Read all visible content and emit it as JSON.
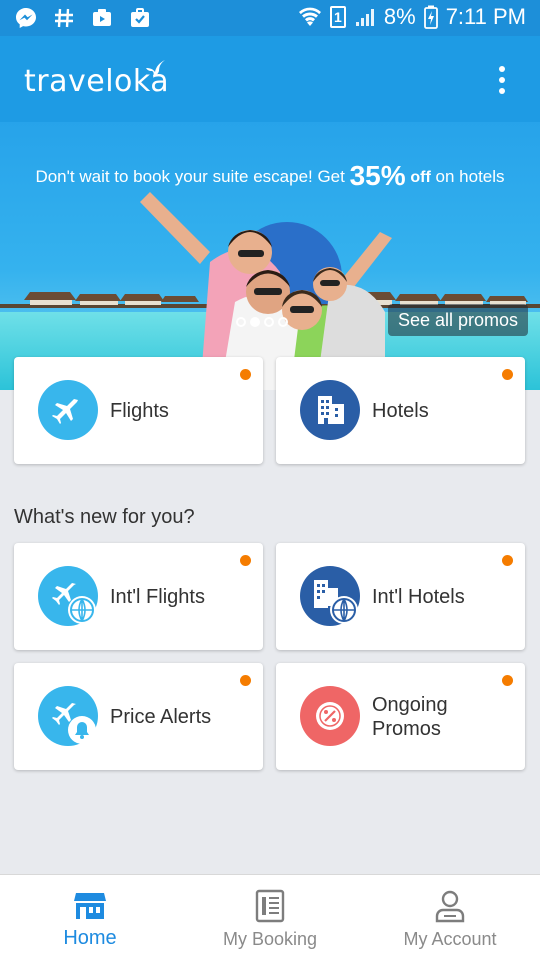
{
  "status_bar": {
    "battery": "8%",
    "time": "7:11 PM",
    "sim": "1",
    "left_icons": [
      "messenger-icon",
      "hashtag-icon",
      "video-icon",
      "briefcase-check-icon"
    ],
    "right_icons": [
      "wifi-icon",
      "signal-icon",
      "battery-charging-icon"
    ]
  },
  "app_bar": {
    "logo": "traveloka",
    "menu_icon": "overflow-menu-icon"
  },
  "banner": {
    "headline_pre": "Don't wait to book your suite escape! Get ",
    "headline_percent": "35%",
    "headline_off": "off",
    "headline_post": " on hotels",
    "see_all": "See all promos",
    "dots_total": 4,
    "dots_active_index": 1
  },
  "primary_cards": [
    {
      "label": "Flights",
      "icon": "plane-icon",
      "color": "#38b6ec"
    },
    {
      "label": "Hotels",
      "icon": "building-icon",
      "color": "#2a5ea6"
    }
  ],
  "section_title": "What's new for you?",
  "new_cards": [
    {
      "label": "Int'l Flights",
      "icon": "plane-globe-icon",
      "color": "#38b6ec"
    },
    {
      "label": "Int'l Hotels",
      "icon": "building-globe-icon",
      "color": "#2a5ea6"
    },
    {
      "label": "Price Alerts",
      "icon": "plane-bell-icon",
      "color": "#38b6ec"
    },
    {
      "label_line1": "Ongoing",
      "label_line2": "Promos",
      "icon": "percent-tag-icon",
      "color": "#ef6666"
    }
  ],
  "accent_color": "#1e9be4",
  "notification_dot_color": "#f57c00",
  "bottom_nav": [
    {
      "label": "Home",
      "icon": "home-store-icon",
      "active": true
    },
    {
      "label": "My Booking",
      "icon": "booking-list-icon",
      "active": false
    },
    {
      "label": "My Account",
      "icon": "account-icon",
      "active": false
    }
  ]
}
